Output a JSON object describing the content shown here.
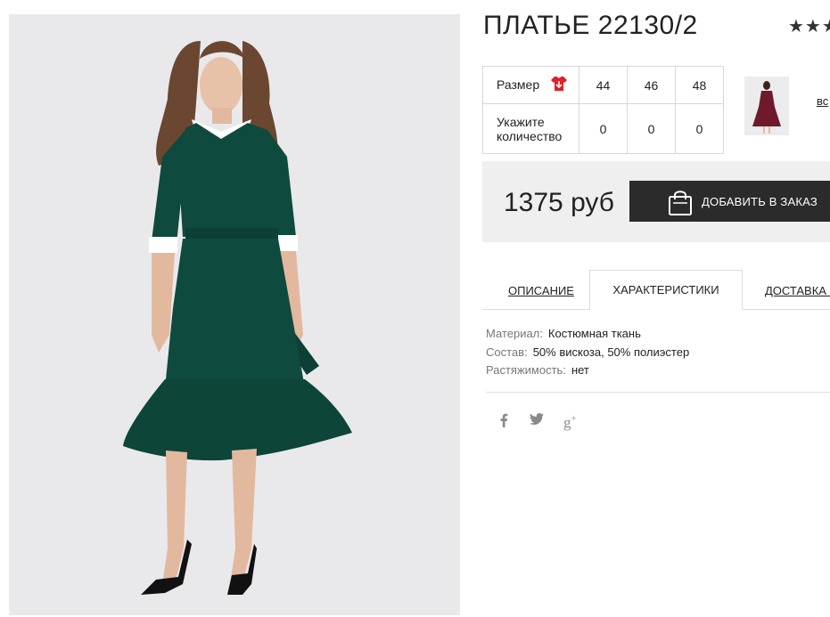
{
  "product": {
    "title": "ПЛАТЬЕ 22130/2",
    "rating_stars": "★★★",
    "image_alt": "dress-photo"
  },
  "size_table": {
    "size_label": "Размер",
    "qty_label_line1": "Укажите",
    "qty_label_line2": "количество",
    "sizes": [
      "44",
      "46",
      "48"
    ],
    "quantities": [
      "0",
      "0",
      "0"
    ]
  },
  "related": {
    "all_link": "вс"
  },
  "purchase": {
    "price": "1375 руб",
    "add_button": "ДОБАВИТЬ В ЗАКАЗ"
  },
  "tabs": {
    "description": "ОПИСАНИЕ",
    "characteristics": "ХАРАКТЕРИСТИКИ",
    "delivery": "ДОСТАВКА И"
  },
  "specs": [
    {
      "key": "Материал:",
      "value": "Костюмная ткань"
    },
    {
      "key": "Состав:",
      "value": "50% вискоза, 50% полиэстер"
    },
    {
      "key": "Растяжимость:",
      "value": "нет"
    }
  ],
  "social": {
    "facebook": "f",
    "twitter": "t",
    "googleplus": "g+"
  },
  "colors": {
    "dress": "#0f4a3e",
    "button": "#2b2b2b",
    "size_icon": "#e31e24",
    "price_bg": "#efefef"
  }
}
